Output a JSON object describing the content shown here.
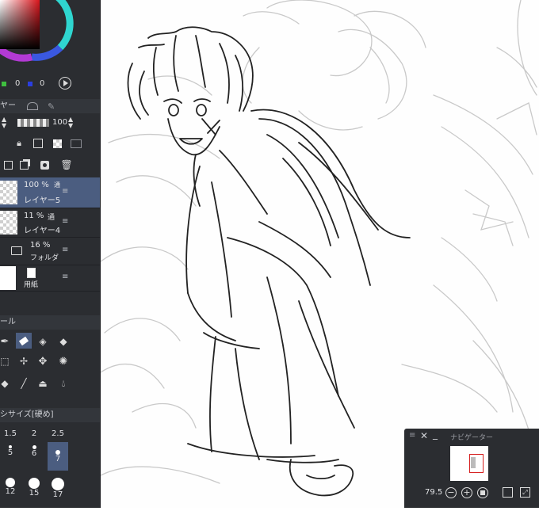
{
  "color": {
    "values": [
      "0",
      "0"
    ],
    "accent": "#3b6fd4"
  },
  "layer_panel": {
    "tab_label": "ヤー",
    "opacity": "100",
    "layers": [
      {
        "percent": "100 %",
        "mode": "通",
        "name": "レイヤー5",
        "selected": true
      },
      {
        "percent": "11 %",
        "mode": "通",
        "name": "レイヤー4",
        "selected": false
      },
      {
        "percent": "16 %",
        "mode": "通",
        "name": "フォルダ",
        "selected": false
      },
      {
        "percent": "",
        "mode": "",
        "name": "用紙",
        "selected": false
      }
    ]
  },
  "tool_panel": {
    "tab_label": "ール"
  },
  "brush_size": {
    "title": "シサイズ[硬め]",
    "row1": [
      "1.5",
      "2",
      "2.5"
    ],
    "row2": [
      "5",
      "6",
      "7"
    ],
    "row3": [
      "12",
      "15",
      "17"
    ]
  },
  "navigator": {
    "title": "ナビゲーター",
    "zoom": "79.5"
  }
}
